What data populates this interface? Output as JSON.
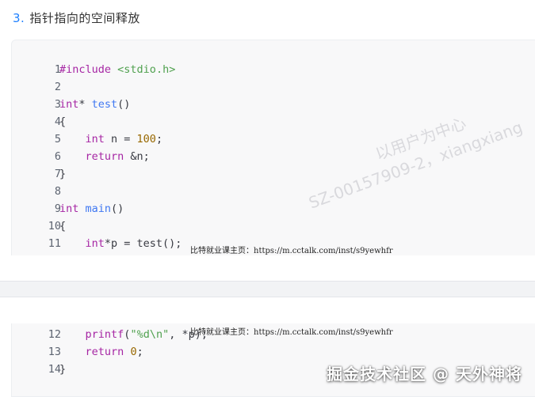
{
  "heading": {
    "number": "3.",
    "title": "指针指向的空间释放"
  },
  "code_top": [
    {
      "n": "1",
      "parts": [
        [
          "inc",
          "#include"
        ],
        [
          "plain",
          " "
        ],
        [
          "hdr",
          "<stdio.h>"
        ]
      ]
    },
    {
      "n": "2",
      "parts": []
    },
    {
      "n": "3",
      "parts": [
        [
          "typ",
          "int"
        ],
        [
          "plain",
          "* "
        ],
        [
          "fn",
          "test"
        ],
        [
          "plain",
          "()"
        ]
      ]
    },
    {
      "n": "4",
      "parts": [
        [
          "plain",
          "{"
        ]
      ]
    },
    {
      "n": "5",
      "parts": [
        [
          "plain",
          "    "
        ],
        [
          "typ",
          "int"
        ],
        [
          "plain",
          " n = "
        ],
        [
          "nm",
          "100"
        ],
        [
          "plain",
          ";"
        ]
      ]
    },
    {
      "n": "6",
      "parts": [
        [
          "plain",
          "    "
        ],
        [
          "kw",
          "return"
        ],
        [
          "plain",
          " &n;"
        ]
      ]
    },
    {
      "n": "7",
      "parts": [
        [
          "plain",
          "}"
        ]
      ]
    },
    {
      "n": "8",
      "parts": []
    },
    {
      "n": "9",
      "parts": [
        [
          "typ",
          "int"
        ],
        [
          "plain",
          " "
        ],
        [
          "fn",
          "main"
        ],
        [
          "plain",
          "()"
        ]
      ]
    },
    {
      "n": "10",
      "parts": [
        [
          "plain",
          "{"
        ]
      ]
    },
    {
      "n": "11",
      "parts": [
        [
          "plain",
          "    "
        ],
        [
          "typ",
          "int"
        ],
        [
          "plain",
          "*p = test();"
        ]
      ]
    }
  ],
  "code_bottom": [
    {
      "n": "12",
      "parts": [
        [
          "plain",
          "    "
        ],
        [
          "kw",
          "printf"
        ],
        [
          "plain",
          "("
        ],
        [
          "str",
          "\"%d\\n\""
        ],
        [
          "plain",
          ", *p);"
        ]
      ]
    },
    {
      "n": "13",
      "parts": [
        [
          "plain",
          "    "
        ],
        [
          "kw",
          "return"
        ],
        [
          "plain",
          " "
        ],
        [
          "nm",
          "0"
        ],
        [
          "plain",
          ";"
        ]
      ]
    },
    {
      "n": "14",
      "parts": [
        [
          "plain",
          "}"
        ]
      ]
    }
  ],
  "watermarks": {
    "footer_note": "比特就业课主页：https://m.cctalk.com/inst/s9yewhfr",
    "diagonal_line1": "以用户为中心",
    "diagonal_line2": "SZ-00157909-2，xiangxiang",
    "site": "掘金技术社区 @ 天外神将"
  },
  "colors": {
    "accent": "#1e80ff",
    "keyword": "#a626a4",
    "function": "#4078f2",
    "number": "#986801",
    "string": "#50a14f"
  }
}
